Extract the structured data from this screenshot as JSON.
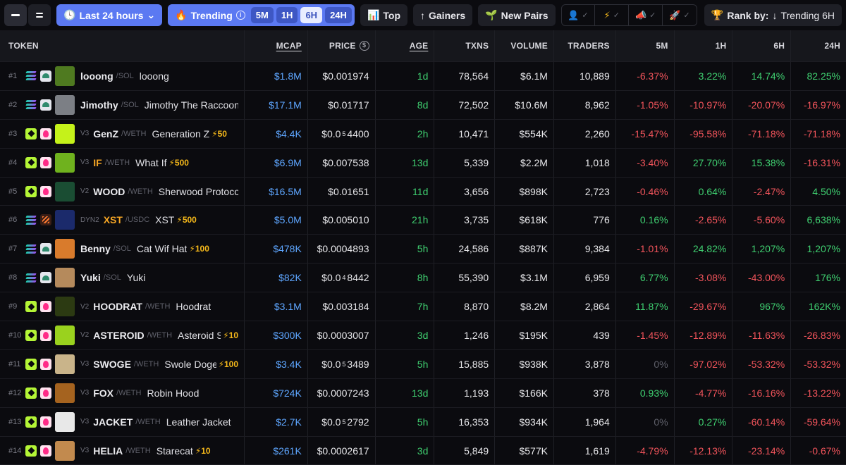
{
  "toolbar": {
    "time_range": "Last 24 hours",
    "trending_label": "Trending",
    "timeframes": [
      "5M",
      "1H",
      "6H",
      "24H"
    ],
    "active_timeframe": "6H",
    "top_label": "Top",
    "gainers_label": "Gainers",
    "new_pairs_label": "New Pairs",
    "rank_prefix": "Rank by:",
    "rank_value": "Trending 6H"
  },
  "columns": {
    "token": "TOKEN",
    "mcap": "MCAP",
    "price": "PRICE",
    "age": "AGE",
    "txns": "TXNS",
    "volume": "VOLUME",
    "traders": "TRADERS",
    "m5": "5M",
    "h1": "1H",
    "h6": "6H",
    "h24": "24H"
  },
  "colors": {
    "accent": "#5b79f2",
    "mcap": "#5ea6ff",
    "positive": "#3fcf70",
    "negative": "#f2545b",
    "boost": "#f5b81a"
  },
  "rows": [
    {
      "rank": "#1",
      "chain": "sol",
      "dex": "raydium",
      "avatar": "#4f7a20",
      "ver": "",
      "sym": "looong",
      "hot": false,
      "quote": "/SOL",
      "name": "looong",
      "boost": "",
      "mcap": "$1.8M",
      "price": "$0.001974",
      "price_sub": "",
      "price_rest": "",
      "age": "1d",
      "txns": "78,564",
      "vol": "$6.1M",
      "traders": "10,889",
      "m5": "-6.37%",
      "h1": "3.22%",
      "h6": "14.74%",
      "h24": "82.25%"
    },
    {
      "rank": "#2",
      "chain": "sol",
      "dex": "raydium",
      "avatar": "#7c7f85",
      "ver": "",
      "sym": "Jimothy",
      "hot": false,
      "quote": "/SOL",
      "name": "Jimothy The Raccoon",
      "boost": "",
      "mcap": "$17.1M",
      "price": "$0.01717",
      "price_sub": "",
      "price_rest": "",
      "age": "8d",
      "txns": "72,502",
      "vol": "$10.6M",
      "traders": "8,962",
      "m5": "-1.05%",
      "h1": "-10.97%",
      "h6": "-20.07%",
      "h24": "-16.97%"
    },
    {
      "rank": "#3",
      "chain": "base",
      "dex": "uni",
      "avatar": "#c5f21a",
      "ver": "V3",
      "sym": "GenZ",
      "hot": false,
      "quote": "/WETH",
      "name": "Generation Z",
      "boost": "⚡50",
      "mcap": "$4.4K",
      "price": "$0.0",
      "price_sub": "5",
      "price_rest": "4400",
      "age": "2h",
      "txns": "10,471",
      "vol": "$554K",
      "traders": "2,260",
      "m5": "-15.47%",
      "h1": "-95.58%",
      "h6": "-71.18%",
      "h24": "-71.18%"
    },
    {
      "rank": "#4",
      "chain": "base",
      "dex": "uni",
      "avatar": "#6fb21e",
      "ver": "V3",
      "sym": "IF",
      "hot": true,
      "quote": "/WETH",
      "name": "What If",
      "boost": "⚡500",
      "mcap": "$6.9M",
      "price": "$0.007538",
      "price_sub": "",
      "price_rest": "",
      "age": "13d",
      "txns": "5,339",
      "vol": "$2.2M",
      "traders": "1,018",
      "m5": "-3.40%",
      "h1": "27.70%",
      "h6": "15.38%",
      "h24": "-16.31%"
    },
    {
      "rank": "#5",
      "chain": "base",
      "dex": "uni",
      "avatar": "#1a4d33",
      "ver": "V2",
      "sym": "WOOD",
      "hot": false,
      "quote": "/WETH",
      "name": "Sherwood Protocol",
      "boost": "",
      "mcap": "$16.5M",
      "price": "$0.01651",
      "price_sub": "",
      "price_rest": "",
      "age": "11d",
      "txns": "3,656",
      "vol": "$898K",
      "traders": "2,723",
      "m5": "-0.46%",
      "h1": "0.64%",
      "h6": "-2.47%",
      "h24": "4.50%"
    },
    {
      "rank": "#6",
      "chain": "sol",
      "dex": "dyn",
      "avatar": "#1b2a6b",
      "ver": "DYN2",
      "sym": "XST",
      "hot": true,
      "quote": "/USDC",
      "name": "XST",
      "boost": "⚡500",
      "mcap": "$5.0M",
      "price": "$0.005010",
      "price_sub": "",
      "price_rest": "",
      "age": "21h",
      "txns": "3,735",
      "vol": "$618K",
      "traders": "776",
      "m5": "0.16%",
      "h1": "-2.65%",
      "h6": "-5.60%",
      "h24": "6,638%"
    },
    {
      "rank": "#7",
      "chain": "sol",
      "dex": "raydium",
      "avatar": "#d97b2c",
      "ver": "",
      "sym": "Benny",
      "hot": false,
      "quote": "/SOL",
      "name": "Cat Wif Hat",
      "boost": "⚡100",
      "mcap": "$478K",
      "price": "$0.0004893",
      "price_sub": "",
      "price_rest": "",
      "age": "5h",
      "txns": "24,586",
      "vol": "$887K",
      "traders": "9,384",
      "m5": "-1.01%",
      "h1": "24.82%",
      "h6": "1,207%",
      "h24": "1,207%"
    },
    {
      "rank": "#8",
      "chain": "sol",
      "dex": "raydium",
      "avatar": "#b58a5c",
      "ver": "",
      "sym": "Yuki",
      "hot": false,
      "quote": "/SOL",
      "name": "Yuki",
      "boost": "",
      "mcap": "$82K",
      "price": "$0.0",
      "price_sub": "4",
      "price_rest": "8442",
      "age": "8h",
      "txns": "55,390",
      "vol": "$3.1M",
      "traders": "6,959",
      "m5": "6.77%",
      "h1": "-3.08%",
      "h6": "-43.00%",
      "h24": "176%"
    },
    {
      "rank": "#9",
      "chain": "base",
      "dex": "uni",
      "avatar": "#2c3a12",
      "ver": "V2",
      "sym": "HOODRAT",
      "hot": false,
      "quote": "/WETH",
      "name": "Hoodrat",
      "boost": "",
      "mcap": "$3.1M",
      "price": "$0.003184",
      "price_sub": "",
      "price_rest": "",
      "age": "7h",
      "txns": "8,870",
      "vol": "$8.2M",
      "traders": "2,864",
      "m5": "11.87%",
      "h1": "-29.67%",
      "h6": "967%",
      "h24": "162K%"
    },
    {
      "rank": "#10",
      "chain": "base",
      "dex": "uni",
      "avatar": "#9ad21e",
      "ver": "V2",
      "sym": "ASTEROID",
      "hot": false,
      "quote": "/WETH",
      "name": "Asteroid Shiba",
      "boost": "⚡10",
      "mcap": "$300K",
      "price": "$0.0003007",
      "price_sub": "",
      "price_rest": "",
      "age": "3d",
      "txns": "1,246",
      "vol": "$195K",
      "traders": "439",
      "m5": "-1.45%",
      "h1": "-12.89%",
      "h6": "-11.63%",
      "h24": "-26.83%"
    },
    {
      "rank": "#11",
      "chain": "base",
      "dex": "uni",
      "avatar": "#c9b48a",
      "ver": "V3",
      "sym": "SWOGE",
      "hot": false,
      "quote": "/WETH",
      "name": "Swole Doge",
      "boost": "⚡100",
      "mcap": "$3.4K",
      "price": "$0.0",
      "price_sub": "5",
      "price_rest": "3489",
      "age": "5h",
      "txns": "15,885",
      "vol": "$938K",
      "traders": "3,878",
      "m5": "0%",
      "h1": "-97.02%",
      "h6": "-53.32%",
      "h24": "-53.32%"
    },
    {
      "rank": "#12",
      "chain": "base",
      "dex": "uni",
      "avatar": "#a5631f",
      "ver": "V3",
      "sym": "FOX",
      "hot": false,
      "quote": "/WETH",
      "name": "Robin Hood",
      "boost": "",
      "mcap": "$724K",
      "price": "$0.0007243",
      "price_sub": "",
      "price_rest": "",
      "age": "13d",
      "txns": "1,193",
      "vol": "$166K",
      "traders": "378",
      "m5": "0.93%",
      "h1": "-4.77%",
      "h6": "-16.16%",
      "h24": "-13.22%"
    },
    {
      "rank": "#13",
      "chain": "base",
      "dex": "uni",
      "avatar": "#e8e8e8",
      "ver": "V3",
      "sym": "JACKET",
      "hot": false,
      "quote": "/WETH",
      "name": "Leather Jacket",
      "boost": "",
      "mcap": "$2.7K",
      "price": "$0.0",
      "price_sub": "5",
      "price_rest": "2792",
      "age": "5h",
      "txns": "16,353",
      "vol": "$934K",
      "traders": "1,964",
      "m5": "0%",
      "h1": "0.27%",
      "h6": "-60.14%",
      "h24": "-59.64%"
    },
    {
      "rank": "#14",
      "chain": "base",
      "dex": "uni",
      "avatar": "#c28a4e",
      "ver": "V3",
      "sym": "HELIA",
      "hot": false,
      "quote": "/WETH",
      "name": "Starecat",
      "boost": "⚡10",
      "mcap": "$261K",
      "price": "$0.0002617",
      "price_sub": "",
      "price_rest": "",
      "age": "3d",
      "txns": "5,849",
      "vol": "$577K",
      "traders": "1,619",
      "m5": "-4.79%",
      "h1": "-12.13%",
      "h6": "-23.14%",
      "h24": "-0.67%"
    }
  ]
}
